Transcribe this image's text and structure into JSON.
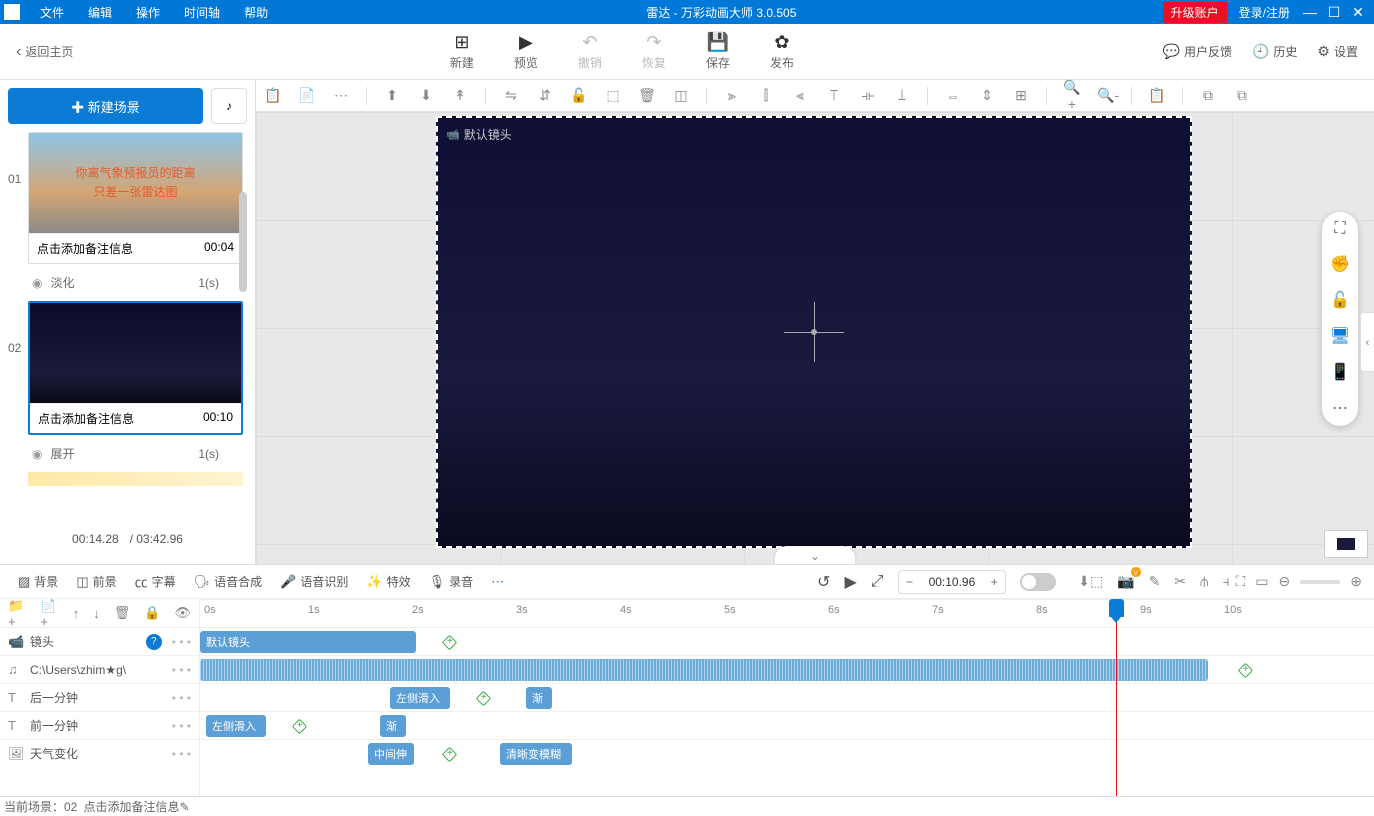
{
  "titlebar": {
    "menus": [
      "文件",
      "编辑",
      "操作",
      "时间轴",
      "帮助"
    ],
    "title": "雷达 - 万彩动画大师 3.0.505",
    "upgrade": "升级账户",
    "login": "登录/注册"
  },
  "toolbar": {
    "back": "返回主页",
    "buttons": {
      "new": "新建",
      "preview": "预览",
      "undo": "撤销",
      "redo": "恢复",
      "save": "保存",
      "publish": "发布"
    },
    "right": {
      "feedback": "用户反馈",
      "history": "历史",
      "settings": "设置"
    }
  },
  "sidebar": {
    "new_scene": "✚ 新建场景",
    "scenes": [
      {
        "num": "01",
        "thumb_line1": "你离气象预报员的距离",
        "thumb_line2": "只差一张雷达图",
        "note": "点击添加备注信息",
        "time": "00:04",
        "transition": "淡化",
        "ttime": "1(s)"
      },
      {
        "num": "02",
        "note": "点击添加备注信息",
        "time": "00:10",
        "transition": "展开",
        "ttime": "1(s)"
      }
    ],
    "current_time": "00:14.28",
    "total_time": "/ 03:42.96"
  },
  "canvas": {
    "camera_label": "默认镜头"
  },
  "timeline": {
    "controls": {
      "bg": "背景",
      "fg": "前景",
      "subtitle": "字幕",
      "tts": "语音合成",
      "asr": "语音识别",
      "fx": "特效",
      "record": "录音"
    },
    "time_value": "00:10.96",
    "ruler": [
      "0s",
      "1s",
      "2s",
      "3s",
      "4s",
      "5s",
      "6s",
      "7s",
      "8s",
      "9s",
      "10s"
    ],
    "tracks": {
      "camera": {
        "label": "镜头",
        "clip": "默认镜头"
      },
      "audio": {
        "label": "C:\\Users\\zhim★g\\"
      },
      "text1": {
        "label": "后一分钟",
        "clip1": "左侧滑入",
        "clip2": "渐"
      },
      "text2": {
        "label": "前一分钟",
        "clip1": "左侧滑入",
        "clip2": "渐"
      },
      "img": {
        "label": "天气变化",
        "clip1": "中间伸",
        "clip2": "清晰变模糊"
      }
    }
  },
  "status": {
    "scene": "当前场景：02",
    "note": "点击添加备注信息"
  }
}
